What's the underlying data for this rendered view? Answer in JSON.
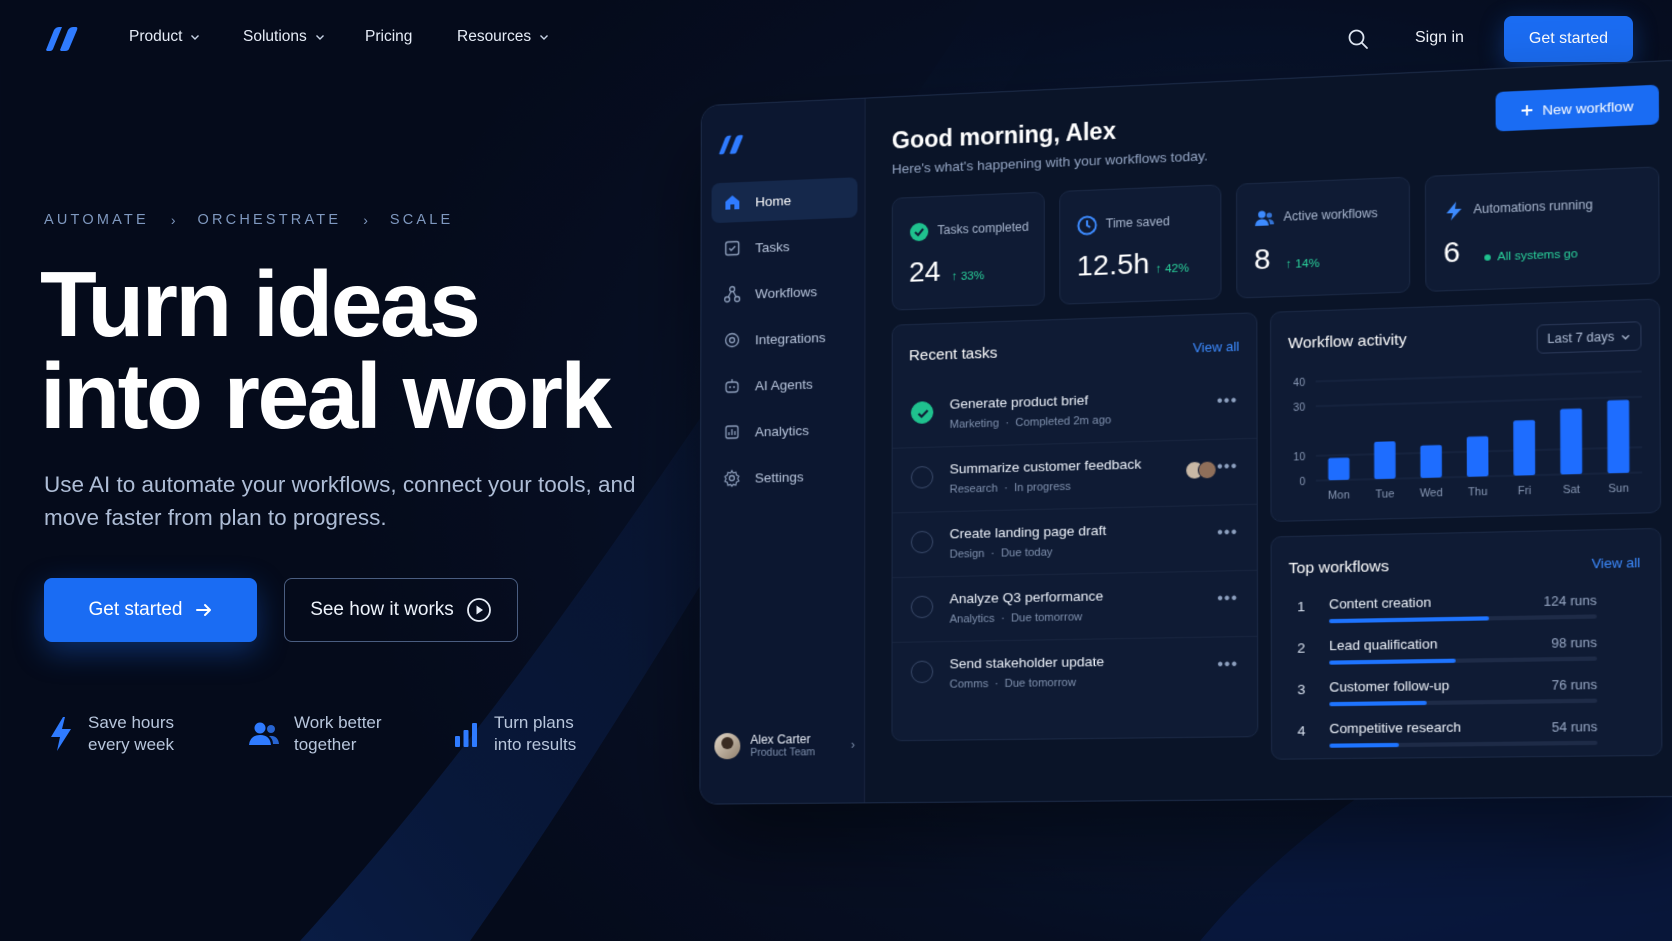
{
  "colors": {
    "accent": "#1a6cf3",
    "success": "#1fc18e",
    "background": "#050b1b"
  },
  "nav": {
    "logo_icon": "brand-logo-icon",
    "links": [
      {
        "label": "Product",
        "has_dropdown": true
      },
      {
        "label": "Solutions",
        "has_dropdown": true
      },
      {
        "label": "Pricing",
        "has_dropdown": false
      },
      {
        "label": "Resources",
        "has_dropdown": true
      }
    ],
    "sign_in": "Sign in",
    "cta": "Get started"
  },
  "hero": {
    "breadcrumb": [
      "AUTOMATE",
      "ORCHESTRATE",
      "SCALE"
    ],
    "title_line1": "Turn ideas",
    "title_line2": "into real work",
    "subtitle": "Use AI to automate your workflows, connect your tools, and move faster from plan to progress.",
    "primary_cta": "Get started",
    "secondary_cta": "See how it works",
    "features": [
      {
        "icon": "lightning-icon",
        "line1": "Save hours",
        "line2": "every week"
      },
      {
        "icon": "team-icon",
        "line1": "Work better",
        "line2": "together"
      },
      {
        "icon": "bar-chart-icon",
        "line1": "Turn plans",
        "line2": "into results"
      }
    ]
  },
  "dashboard": {
    "sidebar": {
      "items": [
        {
          "label": "Home",
          "icon": "home-icon",
          "active": true
        },
        {
          "label": "Tasks",
          "icon": "tasks-icon",
          "active": false
        },
        {
          "label": "Workflows",
          "icon": "workflows-icon",
          "active": false
        },
        {
          "label": "Integrations",
          "icon": "integrations-icon",
          "active": false
        },
        {
          "label": "AI Agents",
          "icon": "ai-agents-icon",
          "active": false
        },
        {
          "label": "Analytics",
          "icon": "analytics-icon",
          "active": false
        },
        {
          "label": "Settings",
          "icon": "settings-icon",
          "active": false
        }
      ],
      "user": {
        "name": "Alex Carter",
        "team": "Product Team"
      }
    },
    "greeting": "Good morning, Alex",
    "greeting_sub": "Here's what's happening with your workflows today.",
    "new_workflow": "New workflow",
    "stats": [
      {
        "label": "Tasks completed",
        "value": "24",
        "delta": "33%",
        "icon": "check-circle-icon"
      },
      {
        "label": "Time saved",
        "value": "12.5h",
        "delta": "42%",
        "icon": "clock-icon"
      },
      {
        "label": "Active workflows",
        "value": "8",
        "delta": "14%",
        "icon": "users-icon"
      },
      {
        "label": "Automations running",
        "value": "6",
        "delta": "All systems go",
        "icon": "lightning-icon"
      }
    ],
    "recent_tasks": {
      "title": "Recent tasks",
      "view_all": "View all",
      "items": [
        {
          "title": "Generate product brief",
          "category": "Marketing",
          "status": "Completed 2m ago",
          "done": true
        },
        {
          "title": "Summarize customer feedback",
          "category": "Research",
          "status": "In progress",
          "done": false
        },
        {
          "title": "Create landing page draft",
          "category": "Design",
          "status": "Due today",
          "done": false
        },
        {
          "title": "Analyze Q3 performance",
          "category": "Analytics",
          "status": "Due tomorrow",
          "done": false
        },
        {
          "title": "Send stakeholder update",
          "category": "Comms",
          "status": "Due tomorrow",
          "done": false
        }
      ]
    },
    "activity": {
      "title": "Workflow activity",
      "range": "Last 7 days"
    },
    "top_workflows": {
      "title": "Top workflows",
      "view_all": "View all",
      "items": [
        {
          "rank": "1",
          "name": "Content creation",
          "runs": "124 runs",
          "value": 124
        },
        {
          "rank": "2",
          "name": "Lead qualification",
          "runs": "98 runs",
          "value": 98
        },
        {
          "rank": "3",
          "name": "Customer follow-up",
          "runs": "76 runs",
          "value": 76
        },
        {
          "rank": "4",
          "name": "Competitive research",
          "runs": "54 runs",
          "value": 54
        }
      ]
    }
  },
  "chart_data": {
    "type": "bar",
    "title": "Workflow activity",
    "categories": [
      "Mon",
      "Tue",
      "Wed",
      "Thu",
      "Fri",
      "Sat",
      "Sun"
    ],
    "values": [
      9,
      15,
      13,
      16,
      22,
      26,
      29
    ],
    "ylim": [
      0,
      40
    ],
    "yticks": [
      0,
      10,
      20,
      30,
      40
    ],
    "ytick_labels": [
      "0",
      "10",
      "30",
      "40"
    ],
    "grid": true
  }
}
